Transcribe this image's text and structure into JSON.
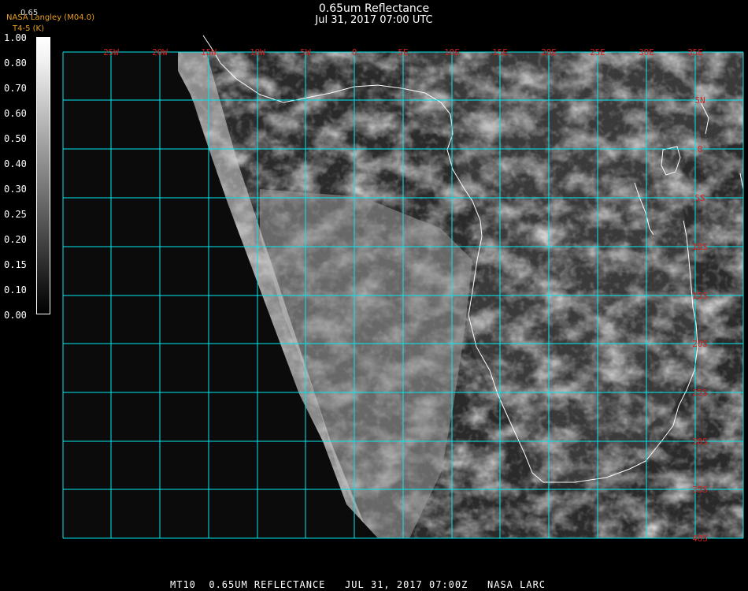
{
  "header": {
    "title": "0.65um Reflectance",
    "datetime": "Jul 31, 2017 07:00 UTC",
    "credit": "NASA Langley (M04.0)",
    "scale_note": "0.65",
    "product_type": "T4-5 (K)"
  },
  "colorbar": {
    "ticks": [
      "1.00",
      "0.80",
      "0.70",
      "0.60",
      "0.50",
      "0.40",
      "0.30",
      "0.25",
      "0.20",
      "0.15",
      "0.10",
      "0.00"
    ]
  },
  "map": {
    "lon_labels": [
      "25W",
      "20W",
      "15W",
      "10W",
      "5W",
      "0",
      "5E",
      "10E",
      "15E",
      "20E",
      "25E",
      "30E",
      "35E"
    ],
    "lat_labels": [
      "5N",
      "0",
      "5S",
      "10S",
      "15S",
      "20S",
      "25S",
      "30S",
      "35S",
      "40S"
    ],
    "grid_color": "#00e8ec",
    "label_color": "#d81e1e",
    "coast_color": "#ffffff"
  },
  "footer": {
    "text": "MT10  0.65UM REFLECTANCE   JUL 31, 2017 07:00Z   NASA LARC"
  }
}
